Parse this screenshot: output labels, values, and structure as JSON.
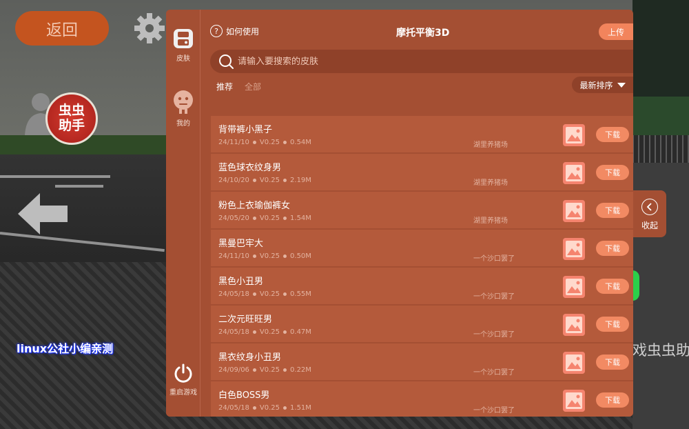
{
  "game": {
    "back_label": "返回",
    "logo_text": "虫虫助手",
    "logo_line1": "虫虫",
    "logo_line2": "助手",
    "watermark": "linux公社小编亲测",
    "side_text": "戏虫虫助"
  },
  "nav": {
    "skin_label": "皮肤",
    "mine_label": "我的",
    "restart_label": "重启游戏"
  },
  "header": {
    "help_label": "如何使用",
    "title": "摩托平衡3D",
    "upload_label": "上传"
  },
  "search": {
    "placeholder": "请输入要搜索的皮肤"
  },
  "tabs": {
    "recommended": "推荐",
    "all": "全部"
  },
  "sort": {
    "label": "最新排序"
  },
  "collapse": {
    "label": "收起"
  },
  "list": {
    "download_label": "下载",
    "items": [
      {
        "name": "背带裤小黑子",
        "date": "24/11/10",
        "version": "V0.25",
        "size": "0.54M",
        "author": "湖里养猪场"
      },
      {
        "name": "蓝色球衣纹身男",
        "date": "24/10/20",
        "version": "V0.25",
        "size": "2.19M",
        "author": "湖里养猪场"
      },
      {
        "name": "粉色上衣瑜伽裤女",
        "date": "24/05/20",
        "version": "V0.25",
        "size": "1.54M",
        "author": "湖里养猪场"
      },
      {
        "name": "黑曼巴牢大",
        "date": "24/11/10",
        "version": "V0.25",
        "size": "0.50M",
        "author": "一个沙口罢了"
      },
      {
        "name": "黑色小丑男",
        "date": "24/05/18",
        "version": "V0.25",
        "size": "0.55M",
        "author": "一个沙口罢了"
      },
      {
        "name": "二次元旺旺男",
        "date": "24/05/18",
        "version": "V0.25",
        "size": "0.47M",
        "author": "一个沙口罢了"
      },
      {
        "name": "黑衣纹身小丑男",
        "date": "24/09/06",
        "version": "V0.25",
        "size": "0.22M",
        "author": "一个沙口罢了"
      },
      {
        "name": "白色BOSS男",
        "date": "24/05/18",
        "version": "V0.25",
        "size": "1.51M",
        "author": "一个沙口罢了"
      }
    ]
  },
  "colors": {
    "panel": "#a44f33",
    "row": "#b45a3b",
    "accent": "#f28a63"
  }
}
